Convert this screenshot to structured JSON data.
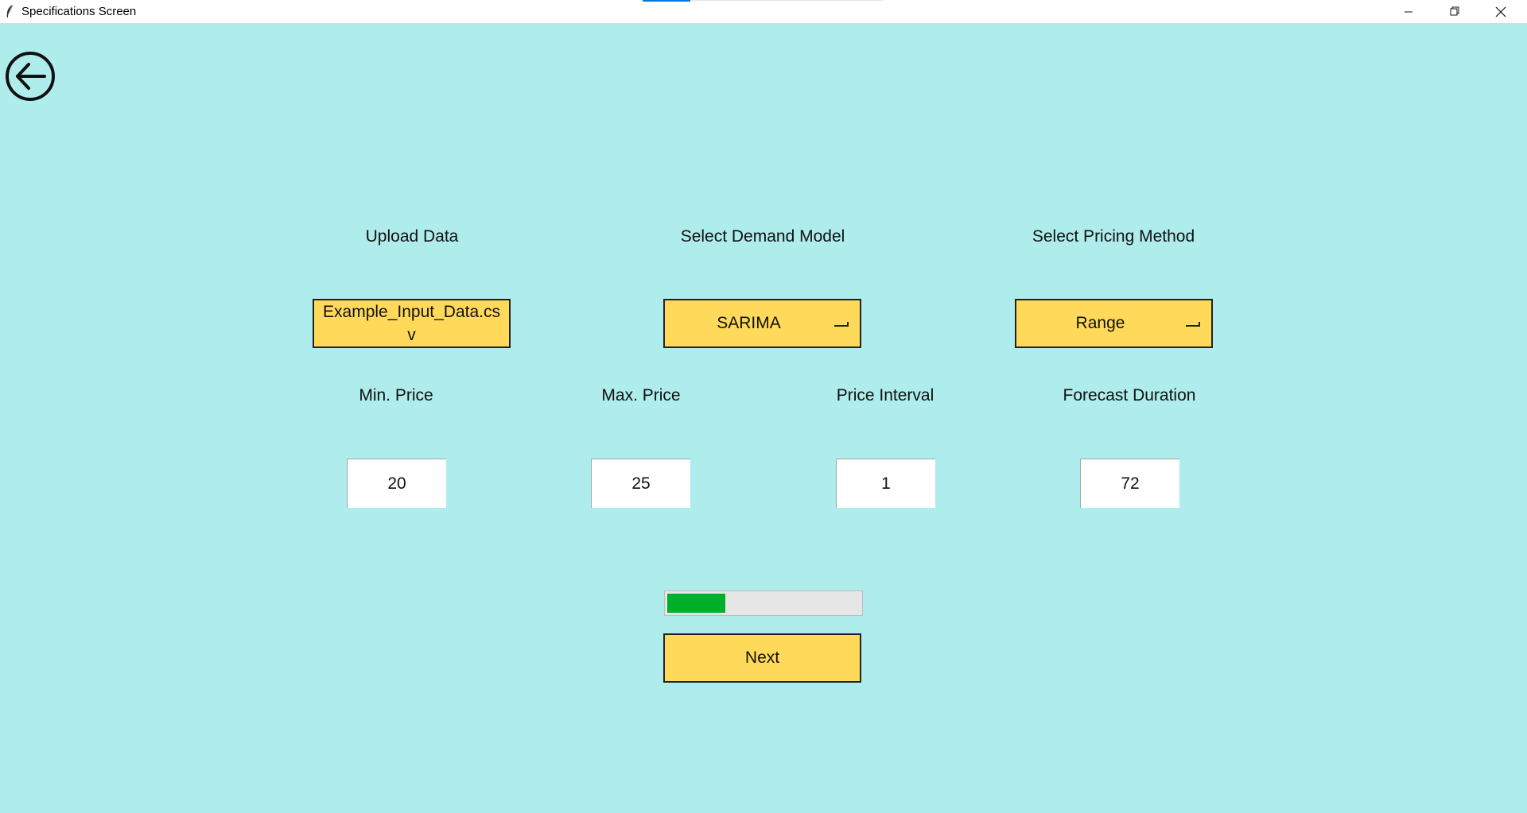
{
  "window": {
    "title": "Specifications Screen",
    "app_icon": "feather-icon",
    "accent_color": "#0078d7",
    "controls": [
      "minimize-icon",
      "restore-icon",
      "close-icon"
    ]
  },
  "back_button": {
    "icon": "back-arrow-icon"
  },
  "upload": {
    "label": "Upload Data",
    "button_text": "Example_Input_Data.csv"
  },
  "demand_model": {
    "label": "Select Demand Model",
    "selected": "SARIMA",
    "indicator_icon": "option-menu-indicator-icon"
  },
  "pricing_method": {
    "label": "Select Pricing Method",
    "selected": "Range",
    "indicator_icon": "option-menu-indicator-icon"
  },
  "fields": {
    "min_price": {
      "label": "Min. Price",
      "value": "20"
    },
    "max_price": {
      "label": "Max. Price",
      "value": "25"
    },
    "price_interval": {
      "label": "Price Interval",
      "value": "1"
    },
    "forecast_duration": {
      "label": "Forecast Duration",
      "value": "72"
    }
  },
  "progress": {
    "value": 0.3,
    "color": "#00b02a"
  },
  "next_button": {
    "label": "Next"
  },
  "colors": {
    "background": "#afecec",
    "button_fill": "#ffd95a"
  }
}
